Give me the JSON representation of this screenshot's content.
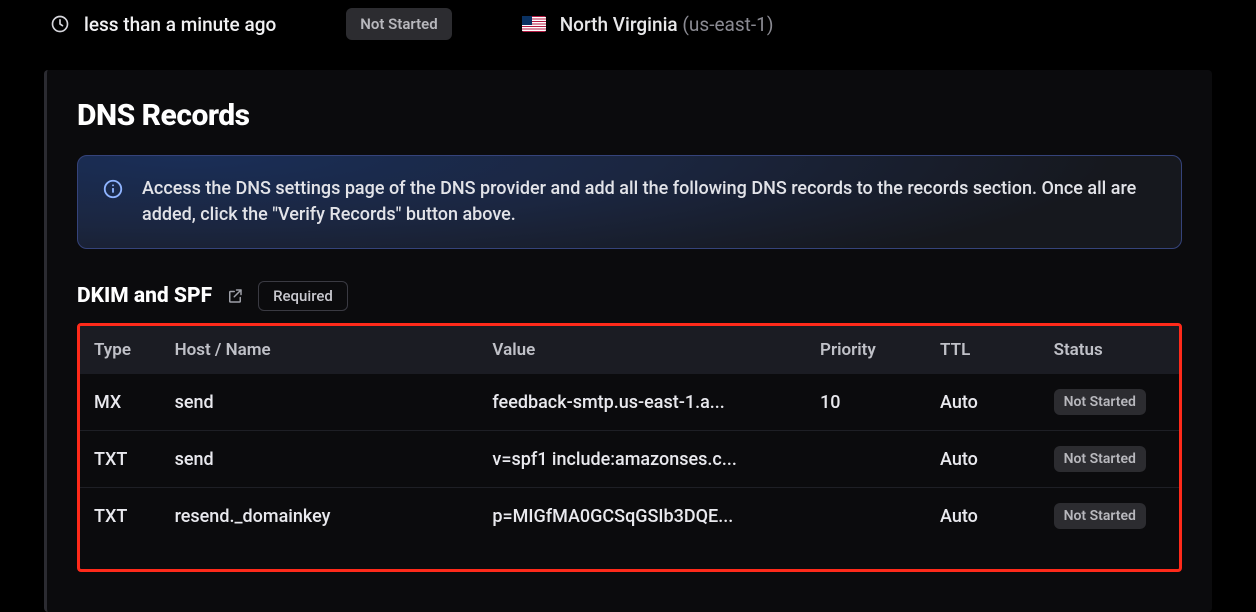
{
  "meta": {
    "timeAgo": "less than a minute ago",
    "statusBadge": "Not Started",
    "regionName": "North Virginia",
    "regionCode": "(us-east-1)"
  },
  "panel": {
    "title": "DNS Records",
    "info": "Access the DNS settings page of the DNS provider and add all the following DNS records to the records section. Once all are added, click the \"Verify Records\" button above."
  },
  "section": {
    "title": "DKIM and SPF",
    "requiredLabel": "Required"
  },
  "table": {
    "headers": {
      "type": "Type",
      "host": "Host / Name",
      "value": "Value",
      "priority": "Priority",
      "ttl": "TTL",
      "status": "Status"
    },
    "rows": [
      {
        "type": "MX",
        "host": "send",
        "value": "feedback-smtp.us-east-1.a...",
        "priority": "10",
        "ttl": "Auto",
        "status": "Not Started"
      },
      {
        "type": "TXT",
        "host": "send",
        "value": "v=spf1 include:amazonses.c...",
        "priority": "",
        "ttl": "Auto",
        "status": "Not Started"
      },
      {
        "type": "TXT",
        "host": "resend._domainkey",
        "value": "p=MIGfMA0GCSqGSIb3DQE...",
        "priority": "",
        "ttl": "Auto",
        "status": "Not Started"
      }
    ]
  }
}
